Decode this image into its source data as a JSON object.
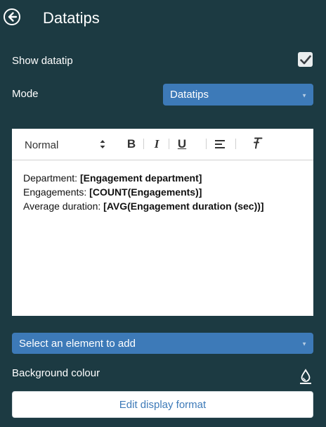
{
  "header": {
    "title": "Datatips",
    "back_icon": "arrow-left-circle-icon"
  },
  "show_datatip": {
    "label": "Show datatip",
    "checked": true
  },
  "mode": {
    "label": "Mode",
    "value": "Datatips"
  },
  "editor": {
    "toolbar": {
      "style_value": "Normal",
      "bold": "B",
      "italic": "I",
      "underline": "U",
      "align_icon": "align-left-icon",
      "clear_format_icon": "clear-format-icon"
    },
    "lines": [
      {
        "label": "Department: ",
        "field": "[Engagement department]"
      },
      {
        "label": "Engagements: ",
        "field": "[COUNT(Engagements)]"
      },
      {
        "label": "Average duration: ",
        "field": "[AVG(Engagement duration (sec))]"
      }
    ]
  },
  "add_element": {
    "placeholder": "Select an element to add"
  },
  "background": {
    "label": "Background colour",
    "icon": "color-drop-icon"
  },
  "edit_format": {
    "label": "Edit display format"
  },
  "colors": {
    "background": "#1c3a42",
    "accent": "#3d7ab8"
  }
}
